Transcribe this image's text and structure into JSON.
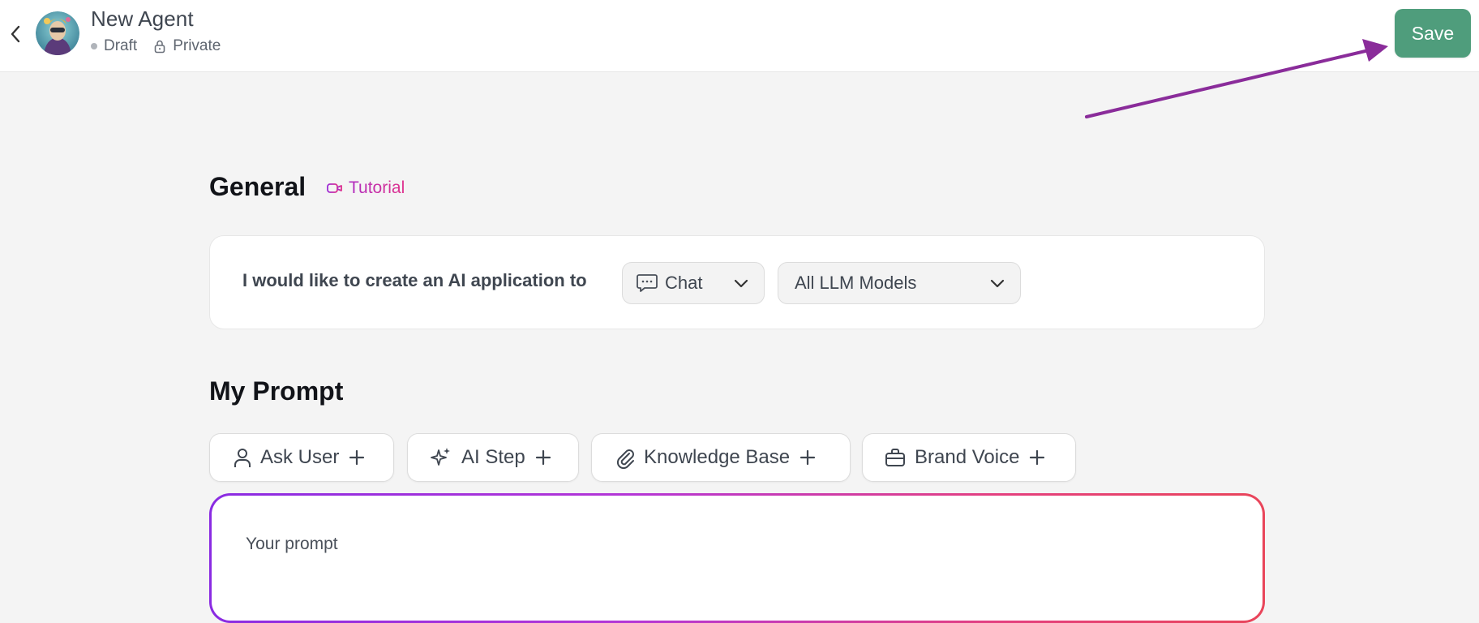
{
  "header": {
    "agent_name": "New Agent",
    "status": "Draft",
    "visibility": "Private",
    "save_label": "Save"
  },
  "general": {
    "title": "General",
    "tutorial_label": "Tutorial",
    "intro_text": "I would like to create an AI application to",
    "mode_value": "Chat",
    "model_value": "All LLM Models"
  },
  "prompt": {
    "title": "My Prompt",
    "chips": [
      {
        "label": "Ask User",
        "icon": "user-icon"
      },
      {
        "label": "AI Step",
        "icon": "sparkle-icon"
      },
      {
        "label": "Knowledge Base",
        "icon": "paperclip-icon"
      },
      {
        "label": "Brand Voice",
        "icon": "briefcase-icon"
      }
    ],
    "placeholder": "Your prompt"
  },
  "colors": {
    "save_button": "#4f9d7c",
    "annotation_arrow": "#8a2c9a",
    "tutorial_gradient_start": "#9b2bd6",
    "tutorial_gradient_end": "#e0318c",
    "prompt_border_start": "#8a2be2",
    "prompt_border_end": "#e9455a"
  }
}
